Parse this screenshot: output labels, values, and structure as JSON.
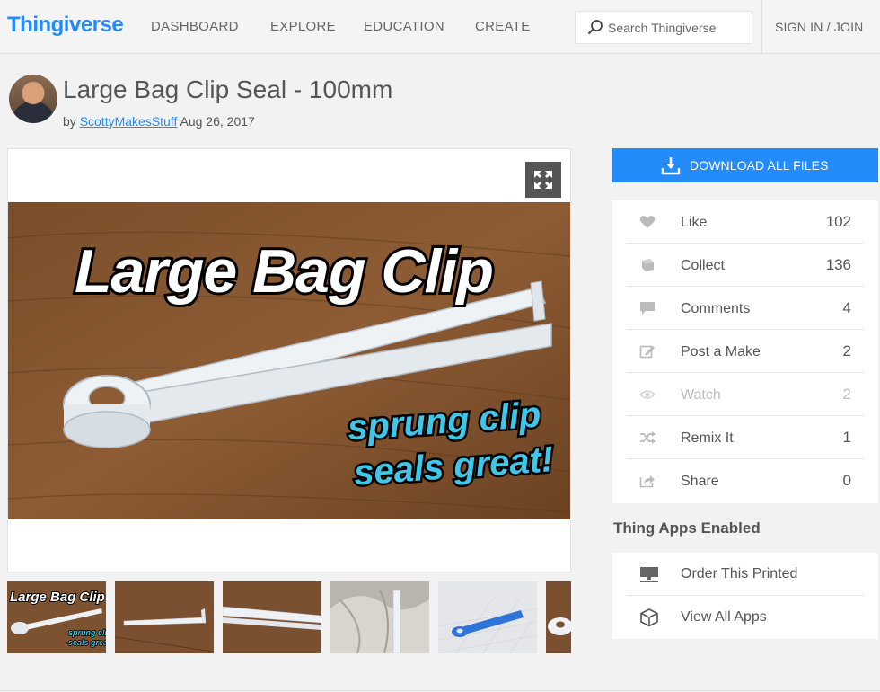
{
  "header": {
    "logo": "Thingiverse",
    "nav": [
      "DASHBOARD",
      "EXPLORE",
      "EDUCATION",
      "CREATE"
    ],
    "search_placeholder": "Search Thingiverse",
    "signin": "SIGN IN / JOIN"
  },
  "thing": {
    "title": "Large Bag Clip Seal - 100mm",
    "by": "by",
    "author": "ScottyMakesStuff",
    "date": "Aug 26, 2017"
  },
  "hero": {
    "headline": "Large Bag Clip",
    "tagline_1": "sprung clip",
    "tagline_2": "seals great!"
  },
  "thumbs": {
    "t1_title": "Large Bag Clip",
    "t1_sub_1": "sprung clip",
    "t1_sub_2": "seals great"
  },
  "sidebar": {
    "download": "DOWNLOAD ALL FILES",
    "stats": [
      {
        "label": "Like",
        "count": "102",
        "icon": "heart-icon"
      },
      {
        "label": "Collect",
        "count": "136",
        "icon": "collect-icon"
      },
      {
        "label": "Comments",
        "count": "4",
        "icon": "comment-icon"
      },
      {
        "label": "Post a Make",
        "count": "2",
        "icon": "edit-icon"
      },
      {
        "label": "Watch",
        "count": "2",
        "icon": "eye-icon"
      },
      {
        "label": "Remix It",
        "count": "1",
        "icon": "shuffle-icon"
      },
      {
        "label": "Share",
        "count": "0",
        "icon": "share-icon"
      }
    ],
    "apps_title": "Thing Apps Enabled",
    "apps": [
      {
        "label": "Order This Printed",
        "icon": "printer-icon"
      },
      {
        "label": "View All Apps",
        "icon": "cube-icon"
      }
    ]
  },
  "colors": {
    "brand": "#248bfb",
    "text": "#555555",
    "disabled": "#bdbdbd"
  }
}
